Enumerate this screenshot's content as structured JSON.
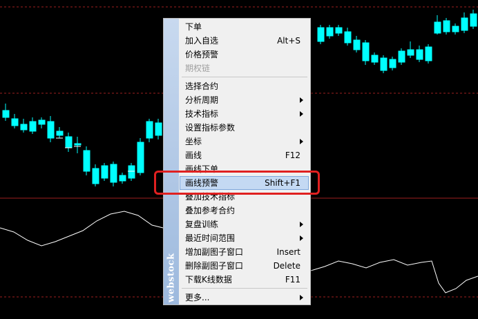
{
  "menu": {
    "brand": "webstock",
    "items": [
      {
        "label": "下单",
        "shortcut": "",
        "submenu": false,
        "disabled": false,
        "active": false
      },
      {
        "label": "加入自选",
        "shortcut": "Alt+S",
        "submenu": false,
        "disabled": false,
        "active": false
      },
      {
        "label": "价格预警",
        "shortcut": "",
        "submenu": false,
        "disabled": false,
        "active": false
      },
      {
        "label": "期权链",
        "shortcut": "",
        "submenu": false,
        "disabled": true,
        "active": false
      },
      {
        "label": "选择合约",
        "shortcut": "",
        "submenu": false,
        "disabled": false,
        "active": false
      },
      {
        "label": "分析周期",
        "shortcut": "",
        "submenu": true,
        "disabled": false,
        "active": false
      },
      {
        "label": "技术指标",
        "shortcut": "",
        "submenu": true,
        "disabled": false,
        "active": false
      },
      {
        "label": "设置指标参数",
        "shortcut": "",
        "submenu": false,
        "disabled": false,
        "active": false
      },
      {
        "label": "坐标",
        "shortcut": "",
        "submenu": true,
        "disabled": false,
        "active": false
      },
      {
        "label": "画线",
        "shortcut": "F12",
        "submenu": false,
        "disabled": false,
        "active": false
      },
      {
        "label": "画线下单",
        "shortcut": "",
        "submenu": false,
        "disabled": false,
        "active": false
      },
      {
        "label": "画线预警",
        "shortcut": "Shift+F1",
        "submenu": false,
        "disabled": false,
        "active": true
      },
      {
        "label": "叠加技术指标",
        "shortcut": "",
        "submenu": false,
        "disabled": false,
        "active": false
      },
      {
        "label": "叠加参考合约",
        "shortcut": "",
        "submenu": false,
        "disabled": false,
        "active": false
      },
      {
        "label": "复盘训练",
        "shortcut": "",
        "submenu": true,
        "disabled": false,
        "active": false
      },
      {
        "label": "最近时间范围",
        "shortcut": "",
        "submenu": true,
        "disabled": false,
        "active": false
      },
      {
        "label": "增加副图子窗口",
        "shortcut": "Insert",
        "submenu": false,
        "disabled": false,
        "active": false
      },
      {
        "label": "删除副图子窗口",
        "shortcut": "Delete",
        "submenu": false,
        "disabled": false,
        "active": false
      },
      {
        "label": "下载K线数据",
        "shortcut": "F11",
        "submenu": false,
        "disabled": false,
        "active": false
      },
      {
        "label": "更多...",
        "shortcut": "",
        "submenu": true,
        "disabled": false,
        "active": false
      }
    ]
  },
  "colors": {
    "background": "#000000",
    "up_candle": "#ff3b3b",
    "down_candle": "#00ffff",
    "neutral_candle": "#ffffff",
    "grid": "#a02020",
    "indicator_line": "#ffffff",
    "highlight": "#e02020",
    "menu_active": "#c4d9f3"
  }
}
